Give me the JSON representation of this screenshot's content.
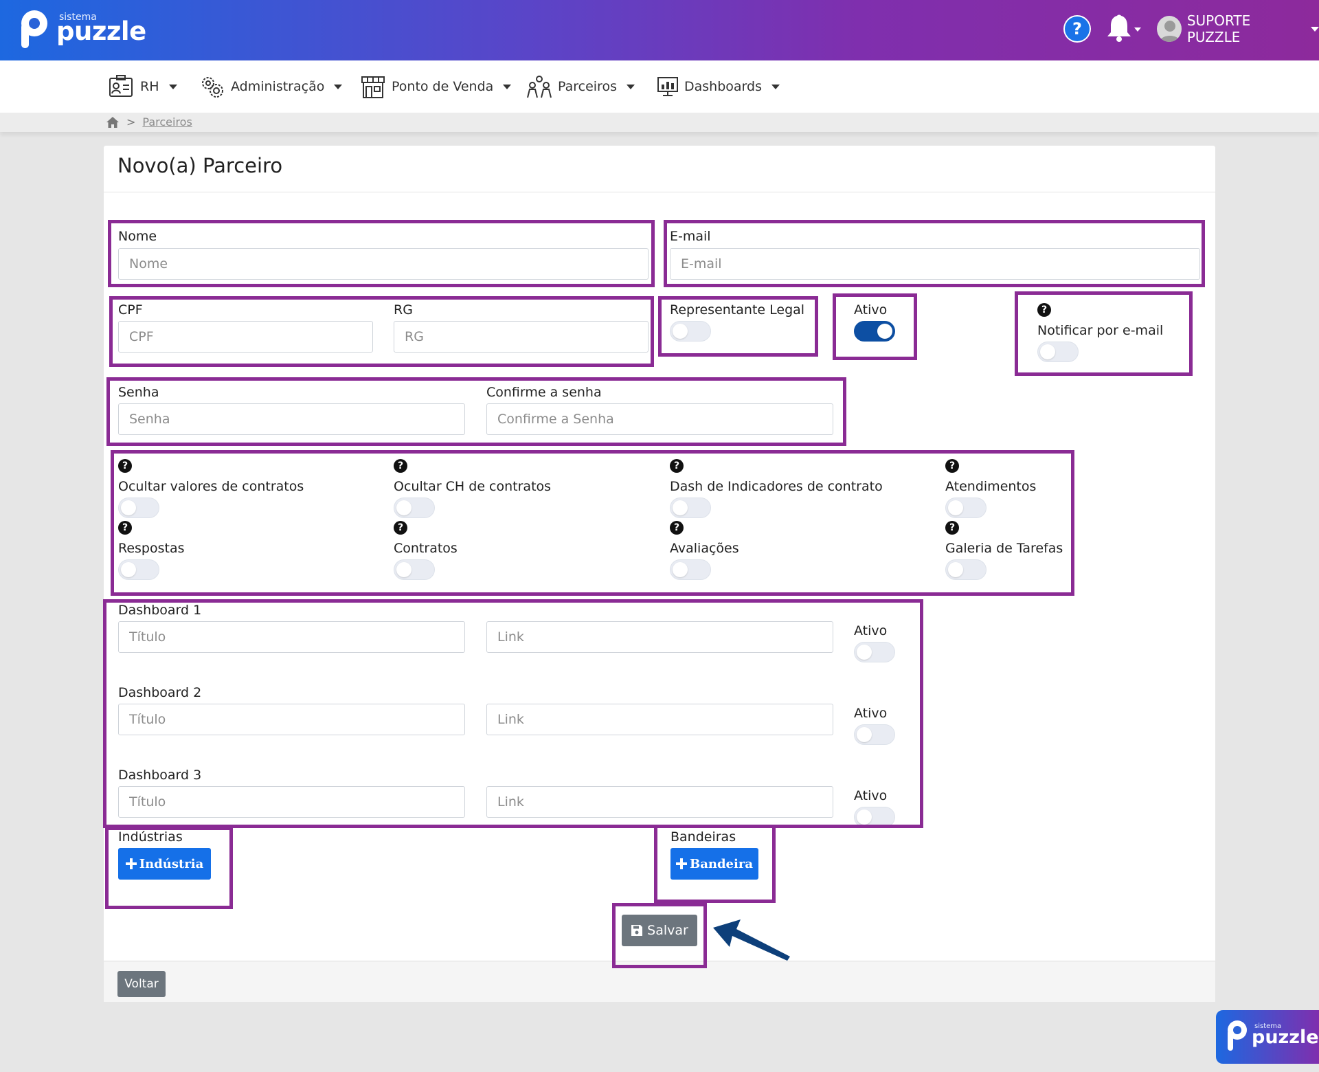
{
  "header": {
    "brand_small": "sistema",
    "brand_word": "puzzle",
    "user_name": "SUPORTE PUZZLE",
    "help_symbol": "?"
  },
  "nav": {
    "items": [
      {
        "label": "RH",
        "icon": "id-card-icon"
      },
      {
        "label": "Administração",
        "icon": "gears-icon"
      },
      {
        "label": "Ponto de Venda",
        "icon": "store-icon"
      },
      {
        "label": "Parceiros",
        "icon": "partners-icon"
      },
      {
        "label": "Dashboards",
        "icon": "monitor-chart-icon"
      }
    ]
  },
  "breadcrumb": {
    "separator": ">",
    "current": "Parceiros"
  },
  "page": {
    "title": "Novo(a) Parceiro"
  },
  "form": {
    "nome": {
      "label": "Nome",
      "placeholder": "Nome"
    },
    "email": {
      "label": "E-mail",
      "placeholder": "E-mail"
    },
    "cpf": {
      "label": "CPF",
      "placeholder": "CPF"
    },
    "rg": {
      "label": "RG",
      "placeholder": "RG"
    },
    "representante_legal": {
      "label": "Representante Legal",
      "on": false
    },
    "ativo": {
      "label": "Ativo",
      "on": true
    },
    "notificar_email": {
      "label": "Notificar por e-mail",
      "on": false
    },
    "senha": {
      "label": "Senha",
      "placeholder": "Senha"
    },
    "confirme_senha": {
      "label": "Confirme a senha",
      "placeholder": "Confirme a Senha"
    },
    "permissions": [
      {
        "label": "Ocultar valores de contratos",
        "on": false
      },
      {
        "label": "Ocultar CH de contratos",
        "on": false
      },
      {
        "label": "Dash de Indicadores de contrato",
        "on": false
      },
      {
        "label": "Atendimentos",
        "on": false
      },
      {
        "label": "Respostas",
        "on": false
      },
      {
        "label": "Contratos",
        "on": false
      },
      {
        "label": "Avaliações",
        "on": false
      },
      {
        "label": "Galeria de Tarefas",
        "on": false
      }
    ],
    "help_symbol": "?",
    "dashboards": [
      {
        "label": "Dashboard 1",
        "title_placeholder": "Título",
        "link_placeholder": "Link",
        "active_label": "Ativo",
        "on": false
      },
      {
        "label": "Dashboard 2",
        "title_placeholder": "Título",
        "link_placeholder": "Link",
        "active_label": "Ativo",
        "on": false
      },
      {
        "label": "Dashboard 3",
        "title_placeholder": "Título",
        "link_placeholder": "Link",
        "active_label": "Ativo",
        "on": false
      }
    ],
    "industrias": {
      "label": "Indústrias",
      "button": "Indústria"
    },
    "bandeiras": {
      "label": "Bandeiras",
      "button": "Bandeira"
    },
    "save_button": "Salvar",
    "back_button": "Voltar"
  },
  "colors": {
    "highlight_frame": "#8a2b94",
    "primary_button": "#1570e8",
    "secondary_button": "#6c757d",
    "toggle_on": "#0d4fa3",
    "arrow": "#0d3f7a"
  },
  "corner_logo": {
    "brand_small": "sistema",
    "brand_word": "puzzle"
  }
}
